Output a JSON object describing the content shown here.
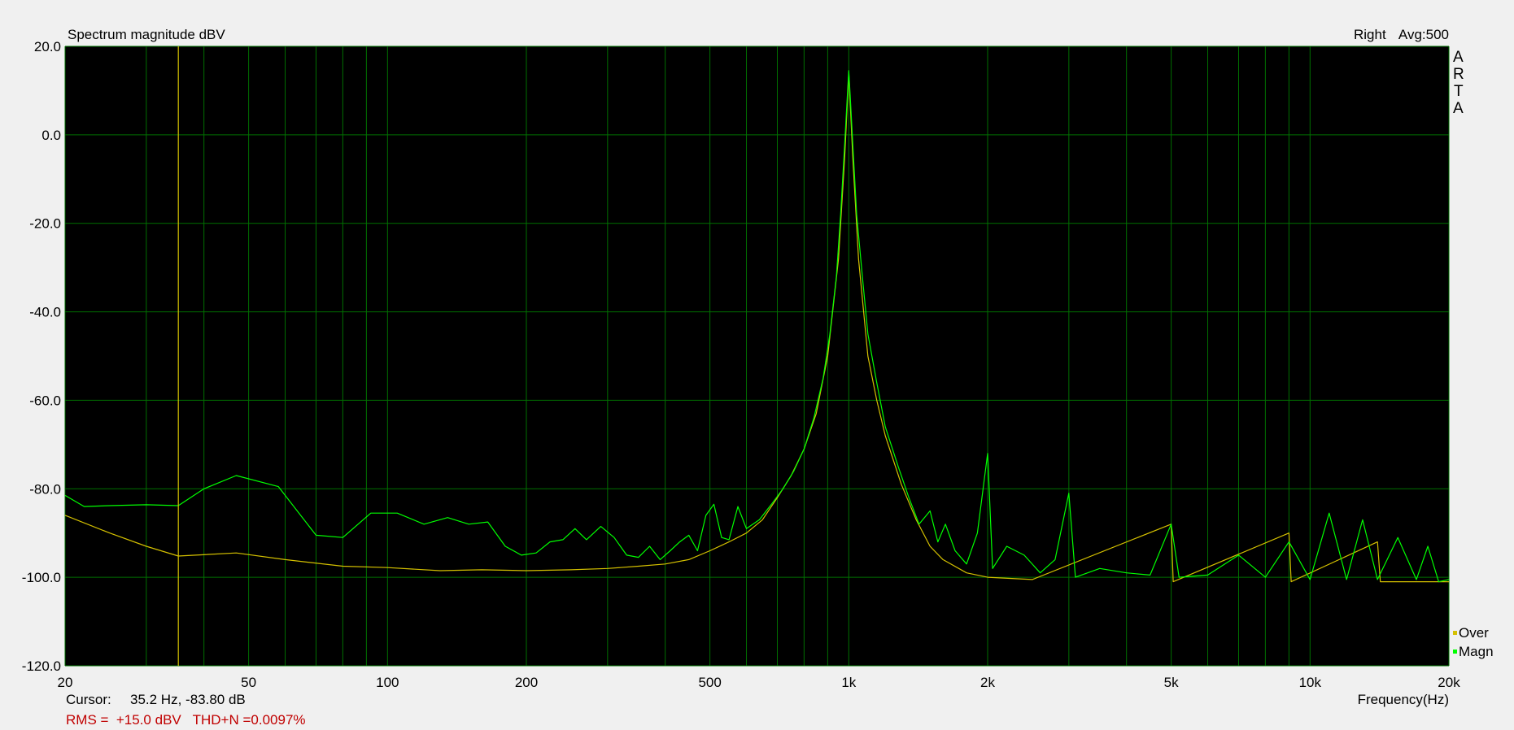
{
  "chart_data": {
    "type": "line",
    "title": "Spectrum magnitude dBV",
    "channel": "Right",
    "averaging": "Avg:500",
    "brand_letters": [
      "A",
      "R",
      "T",
      "A"
    ],
    "xlabel": "Frequency(Hz)",
    "ylabel": "",
    "x_scale": "log",
    "xlim": [
      20,
      20000
    ],
    "ylim": [
      -120,
      20
    ],
    "grid": true,
    "x_ticks": [
      {
        "value": 20,
        "label": "20"
      },
      {
        "value": 50,
        "label": "50"
      },
      {
        "value": 100,
        "label": "100"
      },
      {
        "value": 200,
        "label": "200"
      },
      {
        "value": 500,
        "label": "500"
      },
      {
        "value": 1000,
        "label": "1k"
      },
      {
        "value": 2000,
        "label": "2k"
      },
      {
        "value": 5000,
        "label": "5k"
      },
      {
        "value": 10000,
        "label": "10k"
      },
      {
        "value": 20000,
        "label": "20k"
      }
    ],
    "y_ticks": [
      {
        "value": 20,
        "label": "20.0"
      },
      {
        "value": 0,
        "label": "0.0"
      },
      {
        "value": -20,
        "label": "-20.0"
      },
      {
        "value": -40,
        "label": "-40.0"
      },
      {
        "value": -60,
        "label": "-60.0"
      },
      {
        "value": -80,
        "label": "-80.0"
      },
      {
        "value": -100,
        "label": "-100.0"
      },
      {
        "value": -120,
        "label": "-120.0"
      }
    ],
    "legend": {
      "placement": "bottom-right",
      "entries": [
        {
          "name": "Over",
          "color": "#d4c000"
        },
        {
          "name": "Magn",
          "color": "#00ff00"
        }
      ]
    },
    "cursor": {
      "label": "Cursor:",
      "readout": "35.2 Hz, -83.80 dB",
      "x": 35.2
    },
    "measurement": "RMS =  +15.0 dBV   THD+N =0.0097%",
    "colors": {
      "plot_background": "#000000",
      "grid": "#007000",
      "cursor": "#d4c000",
      "magn": "#00ff00",
      "over": "#d4c000",
      "measurement_text": "#c00000"
    },
    "series": [
      {
        "name": "Magn",
        "color": "#00ff00",
        "points": [
          [
            20,
            -81.5
          ],
          [
            22,
            -84
          ],
          [
            25,
            -83.8
          ],
          [
            30,
            -83.6
          ],
          [
            35.2,
            -83.8
          ],
          [
            40,
            -80
          ],
          [
            47,
            -77
          ],
          [
            58,
            -79.5
          ],
          [
            70,
            -90.5
          ],
          [
            80,
            -91
          ],
          [
            92,
            -85.5
          ],
          [
            105,
            -85.5
          ],
          [
            120,
            -88
          ],
          [
            135,
            -86.5
          ],
          [
            150,
            -88
          ],
          [
            165,
            -87.5
          ],
          [
            180,
            -93
          ],
          [
            195,
            -95
          ],
          [
            210,
            -94.5
          ],
          [
            225,
            -92
          ],
          [
            240,
            -91.5
          ],
          [
            255,
            -89
          ],
          [
            270,
            -91.5
          ],
          [
            290,
            -88.5
          ],
          [
            310,
            -91
          ],
          [
            330,
            -95
          ],
          [
            350,
            -95.5
          ],
          [
            370,
            -93
          ],
          [
            390,
            -96
          ],
          [
            410,
            -94
          ],
          [
            430,
            -92
          ],
          [
            450,
            -90.5
          ],
          [
            470,
            -94
          ],
          [
            490,
            -86
          ],
          [
            510,
            -83.5
          ],
          [
            530,
            -91
          ],
          [
            550,
            -91.5
          ],
          [
            575,
            -84
          ],
          [
            600,
            -89
          ],
          [
            640,
            -87
          ],
          [
            680,
            -83.5
          ],
          [
            720,
            -80
          ],
          [
            760,
            -76
          ],
          [
            800,
            -71
          ],
          [
            840,
            -64
          ],
          [
            880,
            -55
          ],
          [
            910,
            -45
          ],
          [
            940,
            -32
          ],
          [
            960,
            -18
          ],
          [
            980,
            -2
          ],
          [
            993,
            9
          ],
          [
            1000,
            14.5
          ],
          [
            1007,
            9
          ],
          [
            1020,
            -2
          ],
          [
            1040,
            -18
          ],
          [
            1070,
            -32
          ],
          [
            1100,
            -45
          ],
          [
            1150,
            -56
          ],
          [
            1200,
            -66
          ],
          [
            1280,
            -75
          ],
          [
            1350,
            -82
          ],
          [
            1420,
            -88
          ],
          [
            1500,
            -85
          ],
          [
            1560,
            -92
          ],
          [
            1620,
            -88
          ],
          [
            1700,
            -94
          ],
          [
            1800,
            -97
          ],
          [
            1900,
            -90
          ],
          [
            2000,
            -72
          ],
          [
            2050,
            -98
          ],
          [
            2200,
            -93
          ],
          [
            2400,
            -95
          ],
          [
            2600,
            -99
          ],
          [
            2800,
            -96
          ],
          [
            3000,
            -81
          ],
          [
            3100,
            -100
          ],
          [
            3500,
            -98
          ],
          [
            4000,
            -99
          ],
          [
            4500,
            -99.5
          ],
          [
            5000,
            -88
          ],
          [
            5200,
            -100
          ],
          [
            6000,
            -99.5
          ],
          [
            7000,
            -95
          ],
          [
            8000,
            -100
          ],
          [
            9000,
            -92
          ],
          [
            10000,
            -100.5
          ],
          [
            11000,
            -85.5
          ],
          [
            12000,
            -100.5
          ],
          [
            13000,
            -87
          ],
          [
            14000,
            -100.5
          ],
          [
            15500,
            -91
          ],
          [
            17000,
            -100.5
          ],
          [
            18000,
            -93
          ],
          [
            19000,
            -101
          ],
          [
            20000,
            -100.5
          ]
        ]
      },
      {
        "name": "Over",
        "color": "#d4c000",
        "points": [
          [
            20,
            -86
          ],
          [
            25,
            -90
          ],
          [
            30,
            -93
          ],
          [
            35.2,
            -95.2
          ],
          [
            47,
            -94.5
          ],
          [
            60,
            -96
          ],
          [
            80,
            -97.5
          ],
          [
            100,
            -97.8
          ],
          [
            130,
            -98.5
          ],
          [
            160,
            -98.3
          ],
          [
            200,
            -98.5
          ],
          [
            250,
            -98.3
          ],
          [
            300,
            -98
          ],
          [
            350,
            -97.5
          ],
          [
            400,
            -97
          ],
          [
            450,
            -96
          ],
          [
            500,
            -94
          ],
          [
            550,
            -92
          ],
          [
            600,
            -90
          ],
          [
            650,
            -87
          ],
          [
            700,
            -82
          ],
          [
            750,
            -77
          ],
          [
            800,
            -71
          ],
          [
            850,
            -63
          ],
          [
            900,
            -50
          ],
          [
            950,
            -28
          ],
          [
            980,
            -5
          ],
          [
            1000,
            14
          ],
          [
            1020,
            -5
          ],
          [
            1050,
            -28
          ],
          [
            1100,
            -50
          ],
          [
            1150,
            -60
          ],
          [
            1200,
            -68
          ],
          [
            1300,
            -79
          ],
          [
            1400,
            -87
          ],
          [
            1500,
            -93
          ],
          [
            1600,
            -96
          ],
          [
            1800,
            -99
          ],
          [
            2000,
            -100
          ],
          [
            2500,
            -100.5
          ],
          [
            5000,
            -88
          ],
          [
            5050,
            -101
          ],
          [
            9000,
            -90
          ],
          [
            9100,
            -101
          ],
          [
            14000,
            -92
          ],
          [
            14200,
            -101
          ],
          [
            20000,
            -101
          ]
        ]
      }
    ]
  }
}
